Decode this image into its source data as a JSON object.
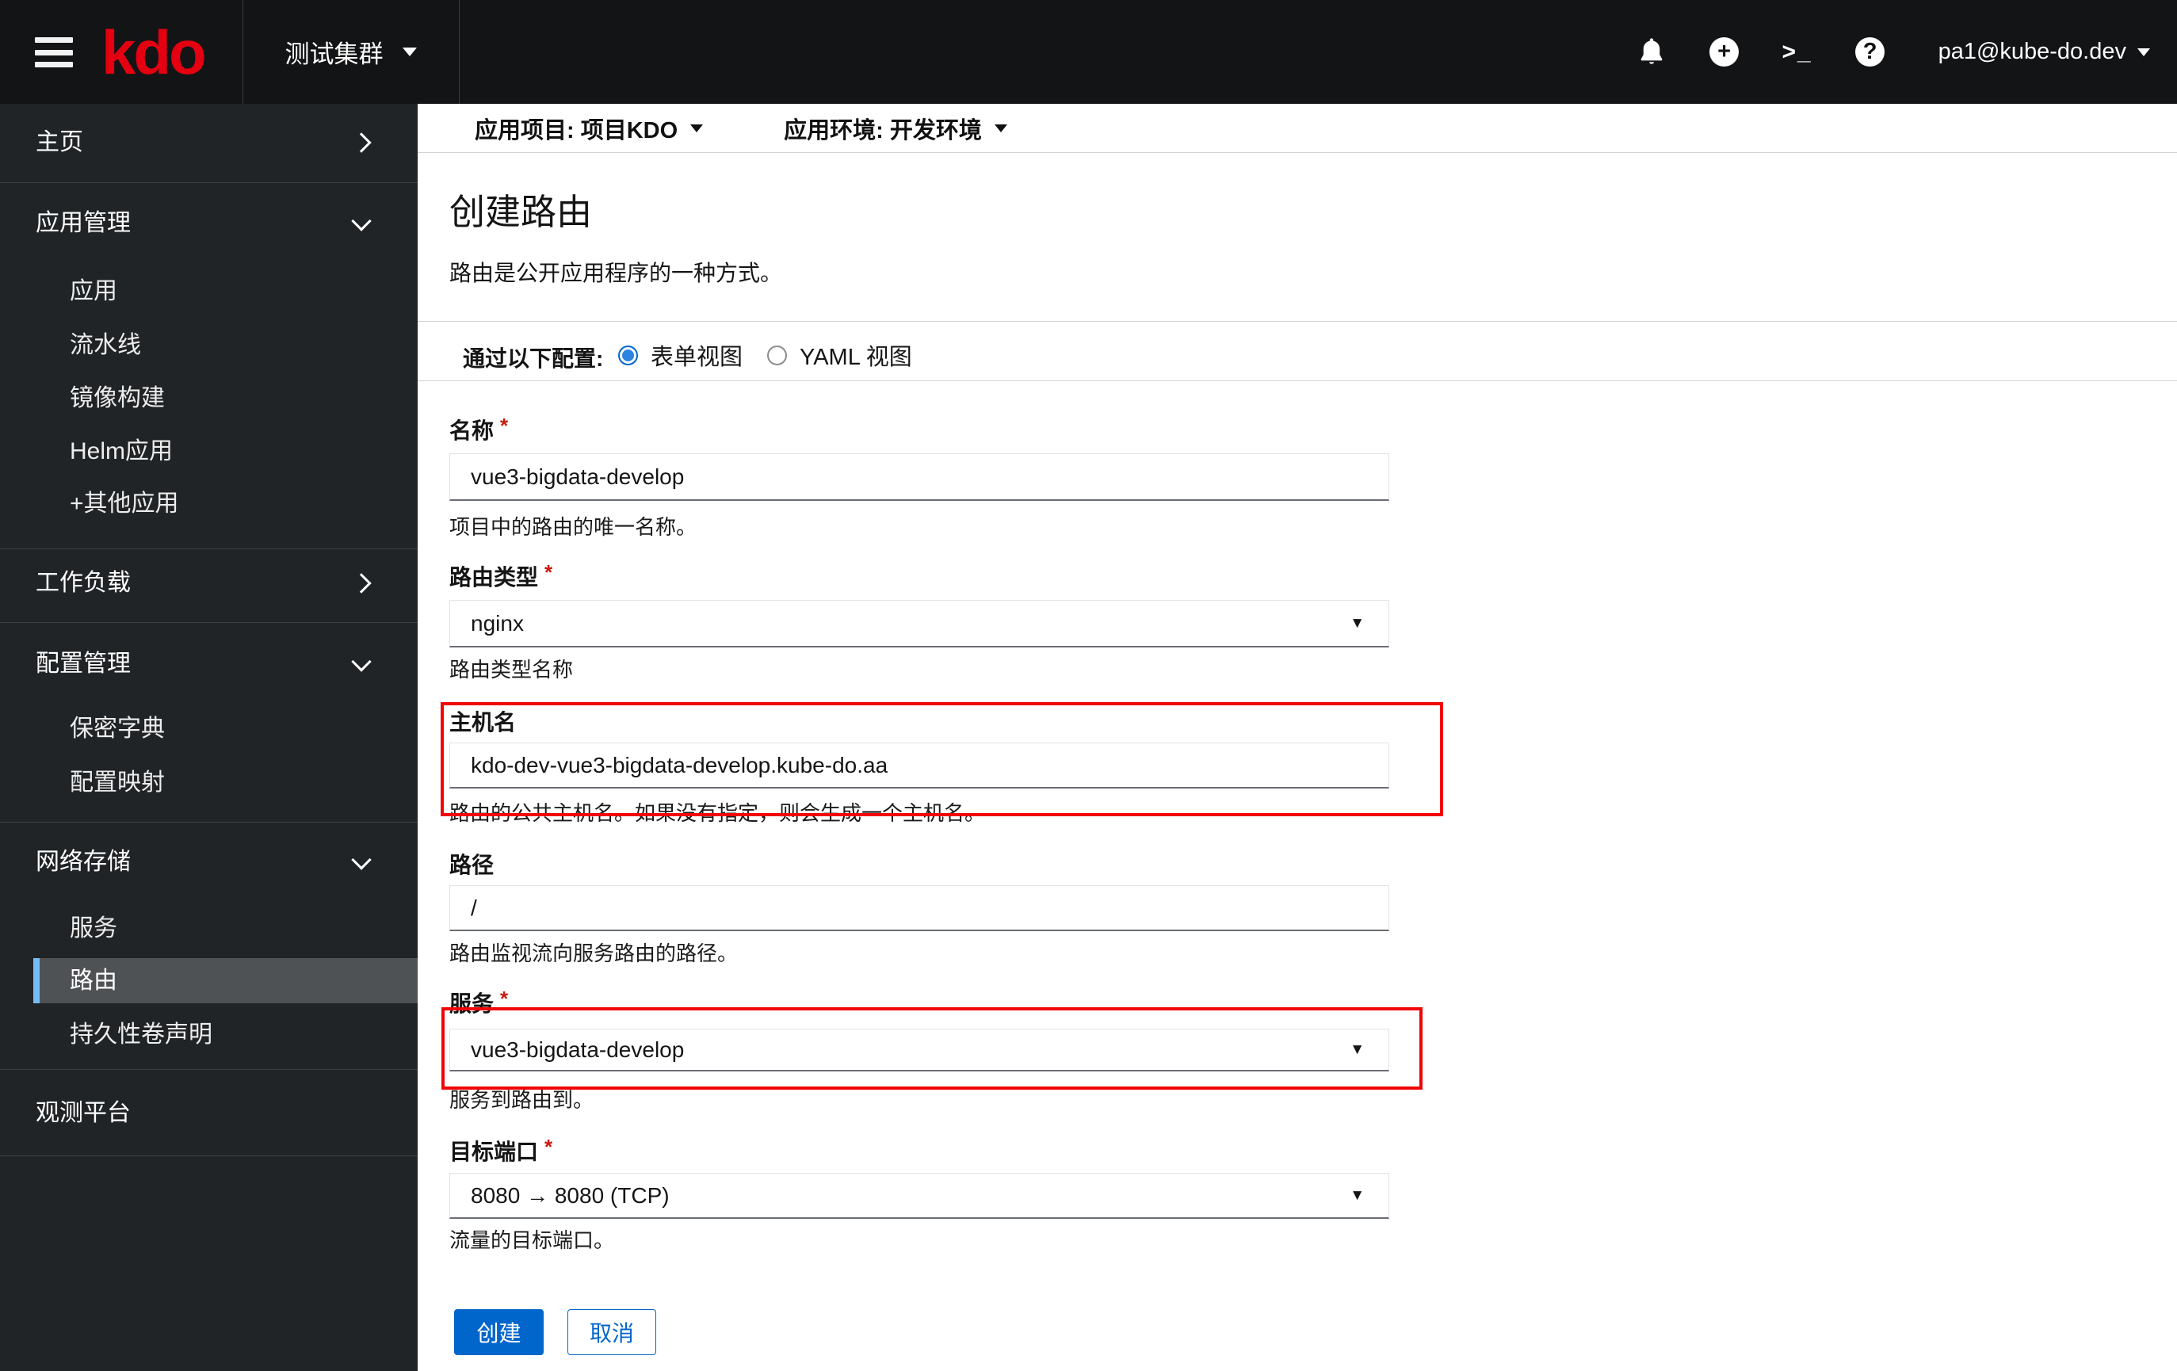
{
  "masthead": {
    "logo": "kdo",
    "cluster": "测试集群",
    "user": "pa1@kube-do.dev",
    "icons": {
      "plus_glyph": "+",
      "terminal_glyph": ">_",
      "help_glyph": "?"
    }
  },
  "context_bar": {
    "project": "应用项目: 项目KDO",
    "environment": "应用环境: 开发环境"
  },
  "sidebar": {
    "items": [
      {
        "label": "主页"
      },
      {
        "label": "应用管理"
      },
      {
        "label": "应用"
      },
      {
        "label": "流水线"
      },
      {
        "label": "镜像构建"
      },
      {
        "label": "Helm应用"
      },
      {
        "label": "+其他应用"
      },
      {
        "label": "工作负载"
      },
      {
        "label": "配置管理"
      },
      {
        "label": "保密字典"
      },
      {
        "label": "配置映射"
      },
      {
        "label": "网络存储"
      },
      {
        "label": "服务"
      },
      {
        "label": "路由"
      },
      {
        "label": "持久性卷声明"
      },
      {
        "label": "观测平台"
      }
    ]
  },
  "page": {
    "title": "创建路由",
    "description": "路由是公开应用程序的一种方式。"
  },
  "view_toggle": {
    "label": "通过以下配置:",
    "form_view": "表单视图",
    "yaml_view": "YAML 视图"
  },
  "form": {
    "required_marker": "*",
    "name": {
      "label": "名称",
      "value": "vue3-bigdata-develop",
      "helper": "项目中的路由的唯一名称。"
    },
    "route_type": {
      "label": "路由类型",
      "value": "nginx",
      "helper": "路由类型名称"
    },
    "hostname": {
      "label": "主机名",
      "value": "kdo-dev-vue3-bigdata-develop.kube-do.aa",
      "helper": "路由的公共主机名。如果没有指定，则会生成一个主机名。"
    },
    "path": {
      "label": "路径",
      "value": "/",
      "helper": "路由监视流向服务路由的路径。"
    },
    "service": {
      "label": "服务",
      "value": "vue3-bigdata-develop",
      "helper": "服务到路由到。"
    },
    "target_port": {
      "label": "目标端口",
      "value": "8080 → 8080 (TCP)",
      "helper": "流量的目标端口。"
    }
  },
  "buttons": {
    "create": "创建",
    "cancel": "取消"
  },
  "ui": {
    "caret": "▼",
    "colors": {
      "accent": "#0066cc",
      "brand_red": "#e40010",
      "annotation_red": "#f20505",
      "nav_selected_border": "#73bcf7",
      "sidebar_bg": "#212427",
      "masthead_bg": "#131416"
    }
  }
}
